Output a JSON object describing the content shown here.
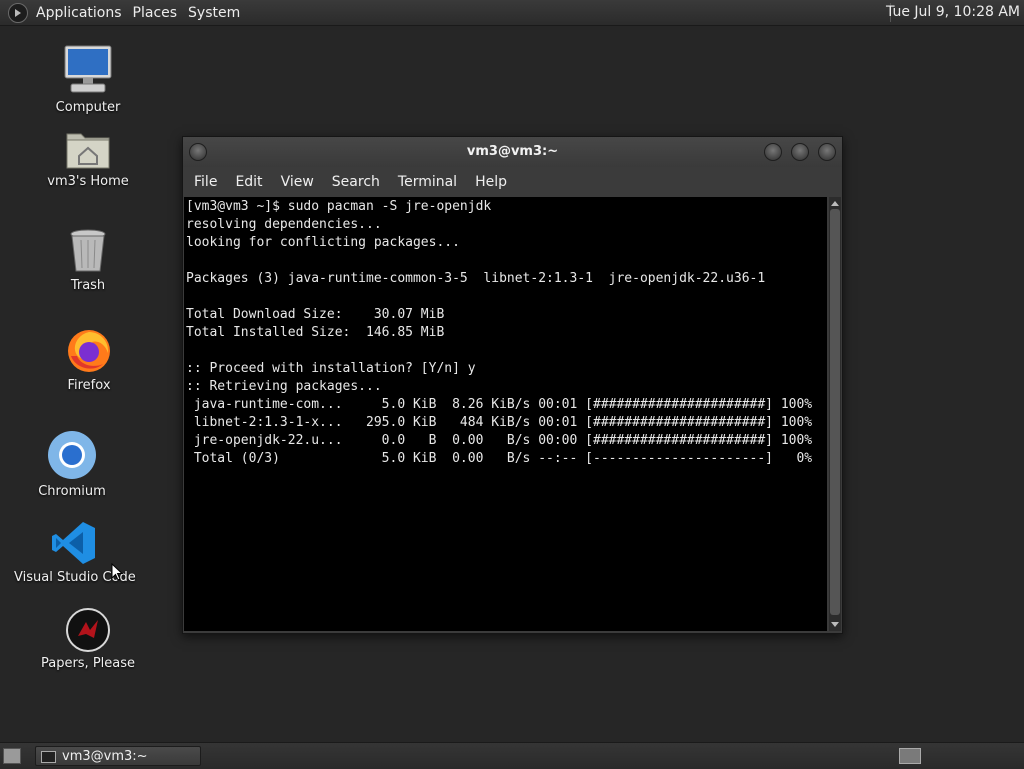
{
  "top_panel": {
    "menus": [
      "Applications",
      "Places",
      "System"
    ],
    "clock": "Tue Jul  9, 10:28 AM"
  },
  "desktop_icons": [
    {
      "label": "Computer",
      "icon": "computer-icon"
    },
    {
      "label": "vm3's Home",
      "icon": "home-folder-icon"
    },
    {
      "label": "Trash",
      "icon": "trash-icon"
    },
    {
      "label": "Firefox",
      "icon": "firefox-icon"
    },
    {
      "label": "Chromium",
      "icon": "chromium-icon"
    },
    {
      "label": "Visual Studio Code",
      "icon": "vscode-icon"
    },
    {
      "label": "Papers, Please",
      "icon": "papers-please-icon"
    }
  ],
  "terminal": {
    "title": "vm3@vm3:~",
    "menu": [
      "File",
      "Edit",
      "View",
      "Search",
      "Terminal",
      "Help"
    ],
    "lines": [
      "[vm3@vm3 ~]$ sudo pacman -S jre-openjdk",
      "resolving dependencies...",
      "looking for conflicting packages...",
      "",
      "Packages (3) java-runtime-common-3-5  libnet-2:1.3-1  jre-openjdk-22.u36-1",
      "",
      "Total Download Size:    30.07 MiB",
      "Total Installed Size:  146.85 MiB",
      "",
      ":: Proceed with installation? [Y/n] y",
      ":: Retrieving packages...",
      " java-runtime-com...     5.0 KiB  8.26 KiB/s 00:01 [######################] 100%",
      " libnet-2:1.3-1-x...   295.0 KiB   484 KiB/s 00:01 [######################] 100%",
      " jre-openjdk-22.u...     0.0   B  0.00   B/s 00:00 [######################] 100%",
      " Total (0/3)             5.0 KiB  0.00   B/s --:-- [----------------------]   0%"
    ]
  },
  "bottom_panel": {
    "task_label": "vm3@vm3:~"
  }
}
